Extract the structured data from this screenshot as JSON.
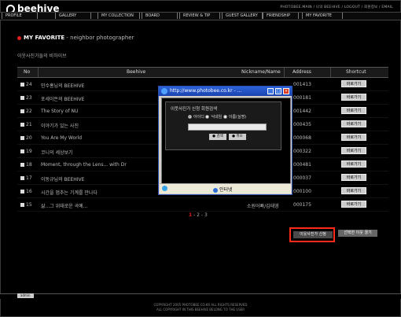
{
  "brand": {
    "logo_text": "beehive"
  },
  "top_links": "PHOTOBEE.MAIN / 나의 BEEHIVE / LOGOUT / 회원정보 / EMAIL",
  "nav": {
    "items": [
      {
        "label": "PROFILE"
      },
      {
        "label": "GALLERY"
      },
      {
        "label": "MY COLLECTION"
      },
      {
        "label": "BOARD"
      },
      {
        "label": "REVIEW & TIP"
      },
      {
        "label": "GUEST GALLERY"
      },
      {
        "label": "FRIENDSHIP"
      },
      {
        "label": "MY FAVORITE"
      }
    ]
  },
  "section": {
    "title": "MY FAVORITE",
    "subtitle": " - neighbor photographer"
  },
  "page_subtitle": "이웃사진가들의 비하이브",
  "table": {
    "columns": {
      "no": "No",
      "beehive": "Beehive",
      "nickname": "Nickname/Name",
      "address": "Address",
      "shortcut": "Shortcut"
    },
    "rows": [
      {
        "no": "24",
        "title": "민수홍님의 BEEHIVE",
        "nick": "",
        "addr": "001413",
        "btn": "바로가기"
      },
      {
        "no": "23",
        "title": "포세이돈의 BEEHIVE",
        "nick": "",
        "addr": "000181",
        "btn": "바로가기"
      },
      {
        "no": "22",
        "title": "The Story of NU",
        "nick": "",
        "addr": "001442",
        "btn": "바로가기"
      },
      {
        "no": "21",
        "title": "이야기가 있는 사진",
        "nick": "",
        "addr": "000435",
        "btn": "바로가기"
      },
      {
        "no": "20",
        "title": "You Are My World",
        "nick": "",
        "addr": "000068",
        "btn": "바로가기"
      },
      {
        "no": "19",
        "title": "코니의 세상보기",
        "nick": "",
        "addr": "000322",
        "btn": "바로가기"
      },
      {
        "no": "18",
        "title": "Moment, through the Lens... with Dr",
        "nick": "",
        "addr": "000481",
        "btn": "바로가기"
      },
      {
        "no": "17",
        "title": "이동규님의 BEEHIVE",
        "nick": "",
        "addr": "000037",
        "btn": "바로가기"
      },
      {
        "no": "16",
        "title": "시간을 멈추는 기계를 만나다",
        "nick": "",
        "addr": "000100",
        "btn": "바로가기"
      },
      {
        "no": "15",
        "title": "삶...그 위태로운 곡예...",
        "nick": "소원어빠/김태영",
        "addr": "000175",
        "btn": "바로가기"
      }
    ]
  },
  "pager": {
    "current": "1",
    "pages": " - 2 - 3"
  },
  "actions": {
    "apply_label": "이웃사진가 신청",
    "delete_label": "선택한 이웃 끊기"
  },
  "admin_label": "admin",
  "footer": {
    "line1": "COPYRIGHT 2005 PHOTOBEE.CO.KR ALL RIGHTS RESERVED",
    "line2": "ALL COPYRIGHT IN THIS BEEHIVE BELONG TO THE USER"
  },
  "popup": {
    "title": "http://www.photobee.co.kr - ...",
    "heading": "이웃사진가 신청 회원검색",
    "radios": [
      {
        "label": "아이디",
        "checked": true
      },
      {
        "label": "닉네임",
        "checked": false
      },
      {
        "label": "이름(실명)",
        "checked": false
      }
    ],
    "search_label": "검색",
    "cancel_label": "취소",
    "status_zone": "인터넷"
  },
  "colors": {
    "accent_red": "#e21c1c",
    "highlight": "#ff2a1a",
    "titlebar_blue": "#2d63d8"
  }
}
